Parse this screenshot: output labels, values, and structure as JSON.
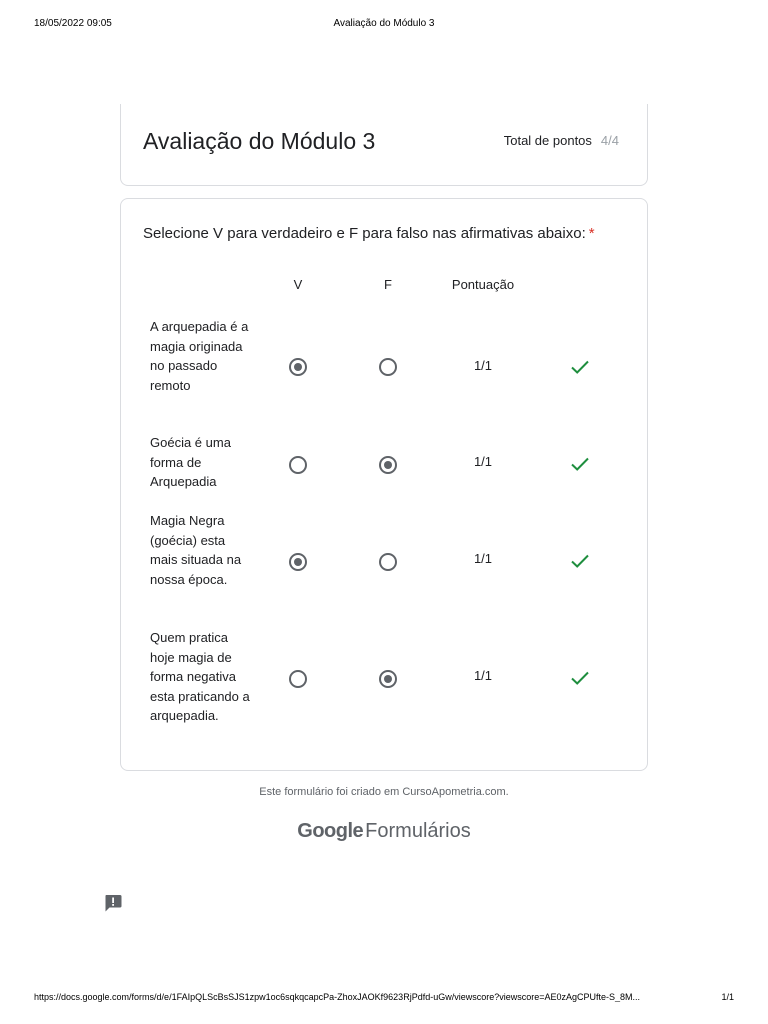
{
  "print_header": {
    "date": "18/05/2022 09:05",
    "title": "Avaliação do Módulo 3"
  },
  "form": {
    "title": "Avaliação do Módulo 3",
    "total_label": "Total de pontos",
    "total_value": "4/4"
  },
  "question": {
    "title": "Selecione V para verdadeiro e F para falso nas afirmativas abaixo:",
    "required_mark": "*",
    "columns": {
      "v": "V",
      "f": "F",
      "score": "Pontuação"
    },
    "rows": [
      {
        "text": "A arquepadia é a magia originada no passado remoto",
        "selected": "V",
        "score": "1/1",
        "correct": true
      },
      {
        "text": "Goécia é uma forma de Arquepadia",
        "selected": "F",
        "score": "1/1",
        "correct": true
      },
      {
        "text": "Magia Negra (goécia) esta mais situada na nossa época.",
        "selected": "V",
        "score": "1/1",
        "correct": true
      },
      {
        "text": "Quem pratica hoje magia de forma negativa esta praticando a arquepadia.",
        "selected": "F",
        "score": "1/1",
        "correct": true
      }
    ]
  },
  "footer": {
    "note": "Este formulário foi criado em CursoApometria.com.",
    "brand_google": "Google",
    "brand_forms": "Formulários"
  },
  "icons": {
    "report": "report-problem-icon",
    "check": "checkmark-icon"
  },
  "colors": {
    "check": "#1e8e3e",
    "required": "#d93025",
    "radio": "#5f6368"
  },
  "print_footer": {
    "url": "https://docs.google.com/forms/d/e/1FAIpQLScBsSJS1zpw1oc6sqkqcapcPa-ZhoxJAOKf9623RjPdfd-uGw/viewscore?viewscore=AE0zAgCPUfte-S_8M...",
    "page": "1/1"
  }
}
